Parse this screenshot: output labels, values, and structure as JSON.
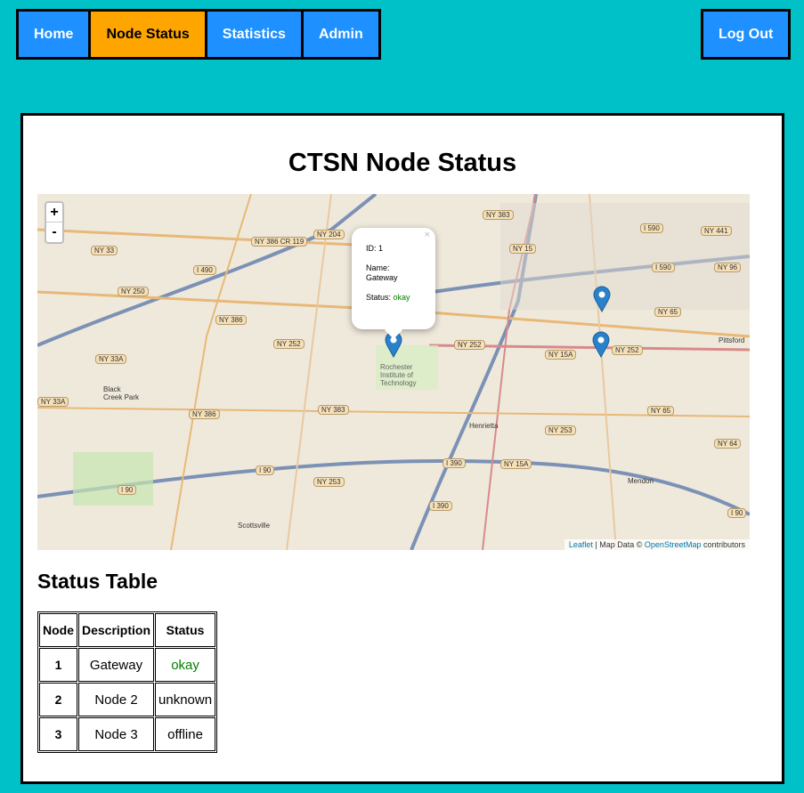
{
  "nav": {
    "items": [
      {
        "label": "Home"
      },
      {
        "label": "Node Status",
        "active": true
      },
      {
        "label": "Statistics"
      },
      {
        "label": "Admin"
      }
    ],
    "logout": "Log Out"
  },
  "title": "CTSN Node Status",
  "map": {
    "zoom_in": "+",
    "zoom_out": "-",
    "attribution": {
      "leaflet": "Leaflet",
      "sep": " | Map Data © ",
      "osm": "OpenStreetMap",
      "contrib": " contributors"
    },
    "popup": {
      "id_label": "ID: 1",
      "name_label": "Name:",
      "name": "Gateway",
      "status_label": "Status: ",
      "status": "okay",
      "close": "×"
    },
    "road_labels": [
      "NY 33",
      "I 490",
      "NY 386 CR 119",
      "NY 204",
      "NY 383",
      "NY 15",
      "I 590",
      "NY 441",
      "NY 250",
      "NY 386",
      "NY 252",
      "NY 33A",
      "NY 252",
      "NY 15A",
      "I 590",
      "NY 65",
      "NY 96",
      "NY 252",
      "NY 383",
      "NY 253",
      "NY 65",
      "NY 64",
      "I 90",
      "I 390",
      "NY 15A",
      "NY 253",
      "I 90",
      "I 390",
      "I 90",
      "NY 33A",
      "NY 386"
    ],
    "places": [
      "Black Creek Park",
      "Rochester Institute of Technology",
      "Henrietta",
      "Pittsford",
      "Scottsville",
      "Mendon"
    ],
    "colors": {
      "marker": "#2a81cb",
      "background": "#efe9dc",
      "highway": "#7b91b5"
    }
  },
  "table": {
    "heading": "Status Table",
    "columns": [
      "Node",
      "Description",
      "Status"
    ],
    "rows": [
      {
        "node": "1",
        "description": "Gateway",
        "status": "okay",
        "color": "#008000"
      },
      {
        "node": "2",
        "description": "Node 2",
        "status": "unknown",
        "color": "#000000"
      },
      {
        "node": "3",
        "description": "Node 3",
        "status": "offline",
        "color": "#000000"
      }
    ]
  }
}
